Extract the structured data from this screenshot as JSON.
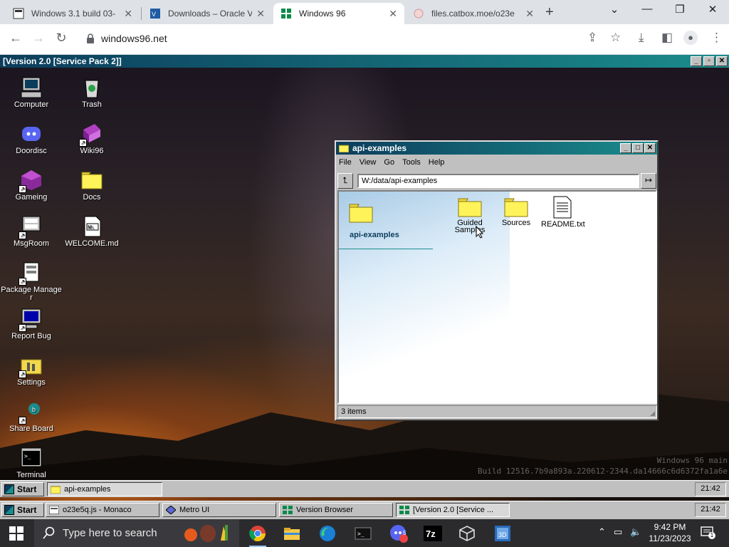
{
  "browser": {
    "tabs": [
      {
        "title": "Windows 3.1 build 03-",
        "active": false
      },
      {
        "title": "Downloads – Oracle V",
        "active": false
      },
      {
        "title": "Windows 96",
        "active": true
      },
      {
        "title": "files.catbox.moe/o23e",
        "active": false
      }
    ],
    "url": "windows96.net",
    "new_tab_symbol": "+"
  },
  "w96": {
    "top_window_title": "[Version 2.0 [Service Pack 2]]",
    "desktop_icons": [
      {
        "label": "Computer",
        "icon": "computer-icon"
      },
      {
        "label": "Trash",
        "icon": "trash-icon"
      },
      {
        "label": "Doordisc",
        "icon": "discord-icon"
      },
      {
        "label": "Wiki96",
        "icon": "book-icon"
      },
      {
        "label": "Gameing",
        "icon": "game-icon"
      },
      {
        "label": "Docs",
        "icon": "folder-icon"
      },
      {
        "label": "MsgRoom",
        "icon": "chat-icon"
      },
      {
        "label": "WELCOME.md",
        "icon": "markdown-icon"
      },
      {
        "label": "Package Manager",
        "icon": "package-icon"
      },
      {
        "label": "Report Bug",
        "icon": "monitor-icon"
      },
      {
        "label": "Settings",
        "icon": "settings-folder-icon"
      },
      {
        "label": "Share Board",
        "icon": "share-icon"
      },
      {
        "label": "Terminal",
        "icon": "terminal-icon"
      }
    ],
    "explorer": {
      "title": "api-examples",
      "menu": [
        "File",
        "View",
        "Go",
        "Tools",
        "Help"
      ],
      "address": "W:/data/api-examples",
      "side_title": "api-examples",
      "files": [
        {
          "label": "Guided Samples",
          "icon": "folder-icon"
        },
        {
          "label": "Sources",
          "icon": "folder-icon"
        },
        {
          "label": "README.txt",
          "icon": "text-file-icon"
        }
      ],
      "status": "3 items"
    },
    "watermark": {
      "line1": "Windows 96 main",
      "line2": "Build 12516.7b9a893a.220612-2344.da14666c6d6372fa1a6e"
    },
    "taskbar1": {
      "start": "Start",
      "tasks": [
        {
          "label": "api-examples"
        }
      ],
      "clock": "21:42"
    },
    "taskbar2": {
      "start": "Start",
      "tasks": [
        {
          "label": "o23e5q.js - Monaco"
        },
        {
          "label": "Metro UI"
        },
        {
          "label": "Version Browser"
        },
        {
          "label": "[Version 2.0 [Service ..."
        }
      ],
      "clock": "21:42"
    }
  },
  "win_taskbar": {
    "search_placeholder": "Type here to search",
    "time": "9:42 PM",
    "date": "11/23/2023",
    "notification_count": "1",
    "discord_badge": "5"
  },
  "colors": {
    "w96_titlebar_start": "#0c3d5c",
    "w96_titlebar_end": "#1b8c8c",
    "w96_face": "#c0c0c0",
    "win_taskbar": "#2b2b2e"
  }
}
